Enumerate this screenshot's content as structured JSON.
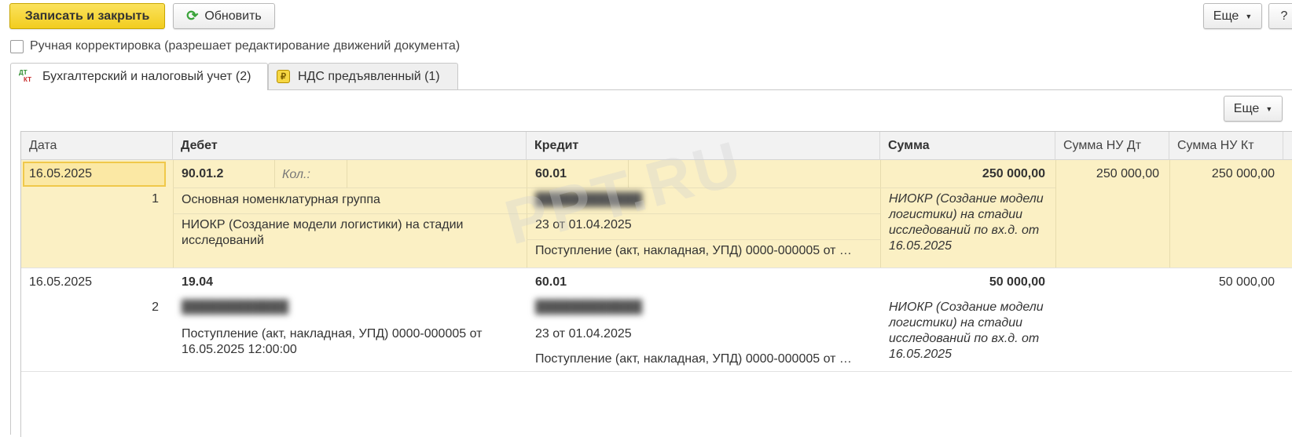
{
  "toolbar": {
    "save_close_label": "Записать и закрыть",
    "refresh_label": "Обновить",
    "more_label": "Еще",
    "help_label": "?"
  },
  "manual_correction": {
    "label": "Ручная корректировка (разрешает редактирование движений документа)",
    "checked": false
  },
  "tabs": [
    {
      "label": "Бухгалтерский и налоговый учет (2)",
      "icon": "dt-kt-icon",
      "active": true
    },
    {
      "label": "НДС предъявленный (1)",
      "icon": "vat-register-icon",
      "active": false
    }
  ],
  "table_toolbar": {
    "more_label": "Еще"
  },
  "table": {
    "columns": [
      "Дата",
      "Дебет",
      "Кредит",
      "Сумма",
      "Сумма НУ Дт",
      "Сумма НУ Кт"
    ],
    "rows": [
      {
        "date": "16.05.2025",
        "number": "1",
        "debit_account": "90.01.2",
        "debit_qty_label": "Кол.:",
        "debit_subconto1": "Основная номенклатурная группа",
        "debit_subconto2": "НИОКР (Создание модели логистики) на стадии исследований",
        "credit_account": "60.01",
        "credit_subconto1": "████████████",
        "credit_subconto2": "23 от 01.04.2025",
        "credit_subconto3": "Поступление (акт, накладная, УПД) 0000-000005 от …",
        "amount": "250 000,00",
        "amount_note": "НИОКР (Создание модели логистики) на стадии исследований по вх.д.  от 16.05.2025",
        "amount_nu_dt": "250 000,00",
        "amount_nu_kt": "250 000,00"
      },
      {
        "date": "16.05.2025",
        "number": "2",
        "debit_account": "19.04",
        "debit_subconto1": "████████████",
        "debit_subconto2": "Поступление (акт, накладная, УПД) 0000-000005 от 16.05.2025 12:00:00",
        "credit_account": "60.01",
        "credit_subconto1": "████████████",
        "credit_subconto2": "23 от 01.04.2025",
        "credit_subconto3": "Поступление (акт, накладная, УПД) 0000-000005 от …",
        "amount": "50 000,00",
        "amount_note": "НИОКР (Создание модели логистики) на стадии исследований по вх.д.  от 16.05.2025",
        "amount_nu_dt": "",
        "amount_nu_kt": "50 000,00"
      }
    ]
  },
  "watermark": "PPT.RU",
  "colors": {
    "primary_button": "#f4d22a",
    "selected_row": "#fbf0c4",
    "header_bg": "#f2f2f2",
    "refresh_icon": "#3aa33a"
  }
}
